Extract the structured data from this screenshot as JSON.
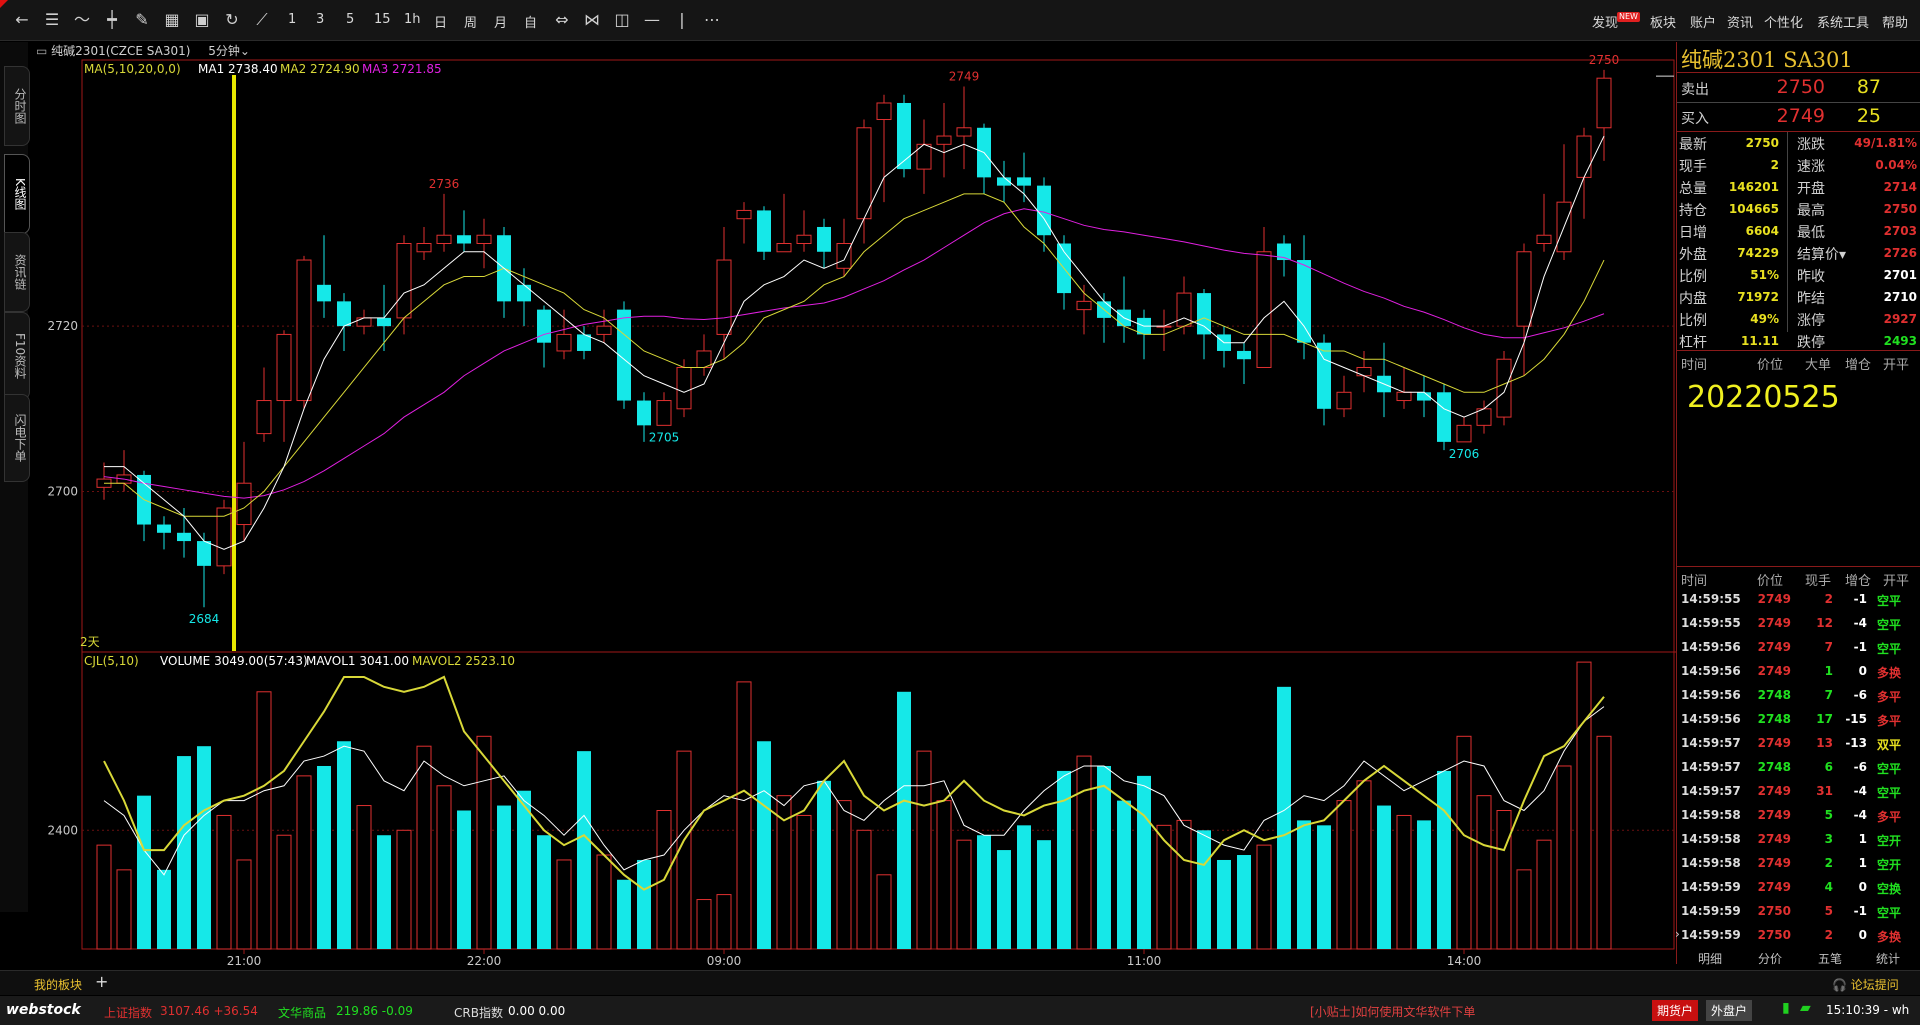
{
  "toolbar": {
    "nums": [
      "1",
      "3",
      "5",
      "15",
      "1h",
      "日",
      "周",
      "月",
      "自"
    ],
    "right_menu": [
      "发现",
      "板块",
      "账户",
      "资讯",
      "个性化",
      "系统工具",
      "帮助"
    ],
    "new_badge": "NEW"
  },
  "side_tabs": [
    "分时图",
    "K线图",
    "资讯链",
    "F10资料",
    "闪电下单"
  ],
  "header": {
    "instrument": "纯碱2301(CZCE SA301)",
    "period": "5分钟",
    "ma_label": "MA(5,10,20,0,0)",
    "ma1": "MA1 2738.40",
    "ma2": "MA2 2724.90",
    "ma3": "MA3 2721.85",
    "days_label": "2天",
    "vol_label": "CJL(5,10)",
    "vol_value": "VOLUME 3049.00(57:43)",
    "mavol1": "MAVOL1 3041.00",
    "mavol2": "MAVOL2 2523.10"
  },
  "colors": {
    "up": "#e03030",
    "down": "#16e8e8",
    "ma1": "#ffffff",
    "ma2": "#d8d838",
    "ma3": "#e020e0",
    "vcursor": "#e8e800",
    "grid": "#6a1010",
    "accent": "#e8c030"
  },
  "chart_data": {
    "type": "candlestick",
    "price_axis": {
      "ticks": [
        2700,
        2720
      ],
      "ylim": [
        2680.7,
        2752.2
      ]
    },
    "volume_axis": {
      "ticks": [
        2400
      ],
      "ylim": [
        0,
        5600
      ]
    },
    "time_ticks": [
      {
        "index": 7,
        "label": "21:00"
      },
      {
        "index": 19,
        "label": "22:00"
      },
      {
        "index": 31,
        "label": "09:00"
      },
      {
        "index": 52,
        "label": "11:00"
      },
      {
        "index": 68,
        "label": "14:00"
      }
    ],
    "highlight_index": 7,
    "candles": [
      [
        2700.5,
        2701.5,
        2703.5,
        2699
      ],
      [
        2701,
        2702,
        2705,
        2700
      ],
      [
        2702,
        2696,
        2702.5,
        2694
      ],
      [
        2696,
        2695,
        2697,
        2693
      ],
      [
        2695,
        2694,
        2698,
        2692
      ],
      [
        2694,
        2691,
        2695,
        2686
      ],
      [
        2691,
        2698,
        2699,
        2690
      ],
      [
        2696,
        2701,
        2706,
        2694
      ],
      [
        2707,
        2711,
        2715,
        2706
      ],
      [
        2711,
        2719,
        2719.5,
        2706
      ],
      [
        2711,
        2728,
        2728.5,
        2710
      ],
      [
        2725,
        2723,
        2731,
        2721
      ],
      [
        2723,
        2720,
        2724,
        2717
      ],
      [
        2720,
        2721,
        2722,
        2719
      ],
      [
        2721,
        2720,
        2725,
        2717
      ],
      [
        2721,
        2730,
        2731,
        2719
      ],
      [
        2729,
        2730,
        2732,
        2728
      ],
      [
        2730,
        2731,
        2736,
        2729
      ],
      [
        2731,
        2730,
        2734,
        2729
      ],
      [
        2730,
        2731,
        2733,
        2727
      ],
      [
        2731,
        2723,
        2732,
        2721
      ],
      [
        2725,
        2723,
        2727,
        2720
      ],
      [
        2722,
        2718,
        2722.5,
        2715
      ],
      [
        2717,
        2719,
        2722,
        2716
      ],
      [
        2719,
        2717,
        2720,
        2716
      ],
      [
        2719,
        2720,
        2722,
        2718
      ],
      [
        2722,
        2711,
        2723,
        2710
      ],
      [
        2711,
        2708,
        2712,
        2706
      ],
      [
        2708,
        2711,
        2712,
        2708
      ],
      [
        2710,
        2715,
        2716,
        2709
      ],
      [
        2715,
        2717,
        2719,
        2714
      ],
      [
        2719,
        2728,
        2732,
        2716
      ],
      [
        2733,
        2734,
        2735,
        2730
      ],
      [
        2734,
        2729,
        2734.5,
        2728
      ],
      [
        2729,
        2730,
        2736,
        2729
      ],
      [
        2730,
        2731,
        2734,
        2729
      ],
      [
        2732,
        2729,
        2733,
        2727
      ],
      [
        2727,
        2730,
        2733,
        2726
      ],
      [
        2733,
        2744,
        2745,
        2730
      ],
      [
        2745,
        2747,
        2748,
        2735
      ],
      [
        2747,
        2739,
        2748,
        2738
      ],
      [
        2739,
        2742,
        2745,
        2736
      ],
      [
        2742,
        2743,
        2747,
        2738
      ],
      [
        2743,
        2744,
        2749,
        2739
      ],
      [
        2744,
        2738,
        2744.5,
        2736
      ],
      [
        2738,
        2737,
        2740,
        2735
      ],
      [
        2738,
        2737,
        2741,
        2735
      ],
      [
        2737,
        2731,
        2738,
        2729
      ],
      [
        2730,
        2724,
        2731,
        2722
      ],
      [
        2722,
        2723,
        2725,
        2719
      ],
      [
        2723,
        2721,
        2724,
        2718
      ],
      [
        2722,
        2720,
        2726,
        2718
      ],
      [
        2721,
        2719,
        2722,
        2716
      ],
      [
        2720,
        2720,
        2722,
        2717
      ],
      [
        2720,
        2724,
        2726,
        2719
      ],
      [
        2724,
        2719,
        2724.5,
        2716
      ],
      [
        2719,
        2717,
        2720,
        2715
      ],
      [
        2717,
        2716,
        2718,
        2713
      ],
      [
        2715,
        2729,
        2732,
        2715
      ],
      [
        2730,
        2728,
        2731,
        2726
      ],
      [
        2728,
        2718,
        2731,
        2716
      ],
      [
        2718,
        2710,
        2719,
        2708
      ],
      [
        2710,
        2712,
        2714,
        2709
      ],
      [
        2714,
        2715,
        2717,
        2712
      ],
      [
        2714,
        2712,
        2718,
        2709
      ],
      [
        2711,
        2712,
        2715,
        2710
      ],
      [
        2712,
        2711,
        2714,
        2709
      ],
      [
        2712,
        2706,
        2713,
        2705
      ],
      [
        2706,
        2708,
        2709,
        2706
      ],
      [
        2708,
        2710,
        2711,
        2707
      ],
      [
        2709,
        2716,
        2717,
        2708
      ],
      [
        2720,
        2729,
        2730,
        2714
      ],
      [
        2730,
        2731,
        2736,
        2729
      ],
      [
        2729,
        2735,
        2742,
        2728
      ],
      [
        2738,
        2743,
        2744,
        2733
      ],
      [
        2744,
        2750,
        2751,
        2740
      ]
    ],
    "ma1": [
      2703,
      2703,
      2701,
      2699,
      2697,
      2694,
      2693,
      2694,
      2698,
      2703,
      2710,
      2716,
      2720,
      2721,
      2721,
      2724,
      2725,
      2727,
      2729,
      2729,
      2727,
      2725,
      2723,
      2721,
      2719,
      2718,
      2716,
      2714,
      2713,
      2712,
      2713,
      2718,
      2723,
      2725,
      2726,
      2728,
      2727,
      2728,
      2733,
      2738,
      2740,
      2742,
      2741,
      2742,
      2741,
      2738,
      2736,
      2733,
      2729,
      2726,
      2723,
      2721,
      2720,
      2720,
      2721,
      2720,
      2718,
      2718,
      2721,
      2723,
      2720,
      2716,
      2715,
      2714,
      2713,
      2712,
      2712,
      2710,
      2709,
      2710,
      2712,
      2718,
      2726,
      2732,
      2738,
      2743
    ],
    "ma2": [
      2701,
      2701,
      2699,
      2698,
      2697,
      2697,
      2697,
      2698,
      2700,
      2703,
      2706,
      2709,
      2712,
      2715,
      2718,
      2721,
      2723,
      2725,
      2726,
      2726,
      2727,
      2726,
      2725,
      2724,
      2722,
      2721,
      2719,
      2717,
      2716,
      2715,
      2715,
      2716,
      2718,
      2721,
      2722,
      2723,
      2725,
      2726,
      2729,
      2731,
      2733,
      2734,
      2735,
      2736,
      2736,
      2735,
      2732,
      2730,
      2727,
      2724,
      2722,
      2720,
      2719,
      2719,
      2720,
      2721,
      2720,
      2719,
      2719,
      2719,
      2718,
      2717,
      2717,
      2716,
      2716,
      2715,
      2714,
      2713,
      2712,
      2712,
      2713,
      2714,
      2716,
      2719,
      2723,
      2728
    ],
    "ma3": [
      2701.8,
      2701.5,
      2701,
      2700.6,
      2700.2,
      2699.8,
      2699.4,
      2699.2,
      2699.5,
      2700.2,
      2701.2,
      2702.5,
      2704,
      2705.5,
      2707,
      2709,
      2710.5,
      2712,
      2714,
      2715.5,
      2717,
      2718,
      2719,
      2719.6,
      2720.2,
      2720.6,
      2721,
      2721.2,
      2721.2,
      2720.9,
      2720.8,
      2721,
      2721.4,
      2721.8,
      2722.2,
      2722.5,
      2722.8,
      2723.5,
      2724.5,
      2725.5,
      2726.8,
      2728,
      2729.5,
      2731,
      2732.5,
      2733.6,
      2734.2,
      2733.8,
      2733,
      2732.2,
      2731.7,
      2731.4,
      2731,
      2730.6,
      2730.2,
      2729.7,
      2729.2,
      2728.8,
      2728.6,
      2728.3,
      2727.4,
      2726.3,
      2725.2,
      2724.2,
      2723.4,
      2722.4,
      2721.7,
      2720.8,
      2719.8,
      2719,
      2718.6,
      2718.6,
      2719.2,
      2719.8,
      2720.6,
      2721.5
    ],
    "volumes": [
      2100,
      1600,
      3100,
      1600,
      3900,
      4100,
      2700,
      1800,
      5200,
      2300,
      3500,
      3700,
      4200,
      2900,
      2300,
      2400,
      4100,
      3300,
      2800,
      4300,
      2900,
      3200,
      2300,
      1800,
      4000,
      1900,
      1400,
      1800,
      2800,
      4000,
      1000,
      1100,
      5400,
      4200,
      3100,
      2700,
      3400,
      3000,
      2400,
      1500,
      5200,
      4000,
      3000,
      2200,
      2300,
      2000,
      2500,
      2200,
      3600,
      3900,
      3700,
      3000,
      3500,
      2500,
      2600,
      2400,
      1800,
      1900,
      2100,
      5300,
      2600,
      2500,
      3000,
      3400,
      2900,
      2700,
      2600,
      3600,
      4300,
      3100,
      2800,
      1600,
      2200,
      3700,
      5800,
      4300,
      4500
    ],
    "mavol1": [
      3000,
      2700,
      2000,
      1500,
      2300,
      2700,
      3000,
      3000,
      3200,
      3300,
      3800,
      3900,
      4100,
      4000,
      3400,
      3200,
      3800,
      3500,
      3300,
      3400,
      3500,
      3000,
      2700,
      2300,
      2700,
      2100,
      1600,
      1800,
      1900,
      2400,
      2800,
      3100,
      3000,
      3200,
      2900,
      3300,
      3400,
      2800,
      2600,
      3000,
      3300,
      3300,
      3400,
      2500,
      2300,
      2300,
      2800,
      3200,
      3500,
      3700,
      3700,
      3400,
      3300,
      3100,
      2500,
      2300,
      2100,
      2000,
      2600,
      2800,
      3100,
      3000,
      3300,
      3800,
      3500,
      3200,
      3400,
      3600,
      3800,
      3700,
      3000,
      2800,
      3200,
      4000,
      4600,
      4900
    ],
    "mavol2": [
      3800,
      3000,
      2000,
      2000,
      2500,
      2800,
      3000,
      3100,
      3300,
      3600,
      4200,
      4800,
      5500,
      5500,
      5300,
      5200,
      5300,
      5500,
      4400,
      3900,
      3400,
      2900,
      2400,
      2100,
      2300,
      1900,
      1500,
      1200,
      1400,
      2200,
      2800,
      3000,
      3200,
      2900,
      2600,
      2800,
      3400,
      3800,
      3100,
      2800,
      3000,
      2900,
      3000,
      3400,
      3000,
      2800,
      2700,
      2900,
      3000,
      3200,
      3300,
      3000,
      2700,
      2200,
      1800,
      1700,
      2200,
      2400,
      2200,
      2300,
      2500,
      2600,
      3000,
      3400,
      3700,
      3400,
      3100,
      2800,
      2300,
      2100,
      2000,
      3000,
      3900,
      4100,
      4600,
      5100
    ],
    "labels": [
      {
        "index": 5,
        "text": "2684",
        "kind": "low"
      },
      {
        "index": 17,
        "text": "2736",
        "kind": "high"
      },
      {
        "index": 28,
        "text": "2705",
        "kind": "low"
      },
      {
        "index": 43,
        "text": "2749",
        "kind": "high"
      },
      {
        "index": 68,
        "text": "2706",
        "kind": "low"
      },
      {
        "index": 75,
        "text": "2750",
        "kind": "high"
      }
    ]
  },
  "quote": {
    "title": "纯碱2301  SA301",
    "ask": {
      "label": "卖出",
      "price": "2750",
      "vol": "87"
    },
    "bid": {
      "label": "买入",
      "price": "2749",
      "vol": "25"
    },
    "stats": [
      [
        "最新",
        "2750",
        "涨跌",
        "49/1.81%"
      ],
      [
        "现手",
        "2",
        "速涨",
        "0.04%"
      ],
      [
        "总量",
        "146201",
        "开盘",
        "2714"
      ],
      [
        "持仓",
        "104665",
        "最高",
        "2750"
      ],
      [
        "日增",
        "6604",
        "最低",
        "2703"
      ],
      [
        "外盘",
        "74229",
        "结算价▾",
        "2726"
      ],
      [
        "比例",
        "51%",
        "昨收",
        "2701"
      ],
      [
        "内盘",
        "71972",
        "昨结",
        "2710"
      ],
      [
        "比例",
        "49%",
        "涨停",
        "2927"
      ],
      [
        "杠杆",
        "11.11",
        "跌停",
        "2493"
      ]
    ],
    "big_order_head": [
      "时间",
      "价位",
      "大单",
      "增仓",
      "开平"
    ],
    "date": "20220525",
    "ticks_head": [
      "时间",
      "价位",
      "现手",
      "增仓",
      "开平"
    ],
    "ticks": [
      [
        "14:59:55",
        "2749",
        "2",
        "-1",
        "空平"
      ],
      [
        "14:59:55",
        "2749",
        "12",
        "-4",
        "空平"
      ],
      [
        "14:59:56",
        "2749",
        "7",
        "-1",
        "空平"
      ],
      [
        "14:59:56",
        "2749",
        "1",
        "0",
        "多换"
      ],
      [
        "14:59:56",
        "2748",
        "7",
        "-6",
        "多平"
      ],
      [
        "14:59:56",
        "2748",
        "17",
        "-15",
        "多平"
      ],
      [
        "14:59:57",
        "2749",
        "13",
        "-13",
        "双平"
      ],
      [
        "14:59:57",
        "2748",
        "6",
        "-6",
        "空平"
      ],
      [
        "14:59:57",
        "2749",
        "31",
        "-4",
        "空平"
      ],
      [
        "14:59:58",
        "2749",
        "5",
        "-4",
        "多平"
      ],
      [
        "14:59:58",
        "2749",
        "3",
        "1",
        "空开"
      ],
      [
        "14:59:58",
        "2749",
        "2",
        "1",
        "空开"
      ],
      [
        "14:59:59",
        "2749",
        "4",
        "0",
        "空换"
      ],
      [
        "14:59:59",
        "2750",
        "5",
        "-1",
        "空平"
      ],
      [
        "14:59:59",
        "2750",
        "2",
        "0",
        "多换"
      ]
    ],
    "bottom_tabs": [
      "明细",
      "分价",
      "五笔",
      "统计"
    ]
  },
  "footer": {
    "my_board": "我的板块",
    "logo": "webstock",
    "idx1_name": "上证指数",
    "idx1_val": "3107.46 +36.54",
    "idx2_name": "文华商品",
    "idx2_val": "219.86 -0.09",
    "idx3_name": "CRB指数",
    "idx3_val": "0.00 0.00",
    "forum": "论坛提问",
    "tip": "[小贴士]如何使用文华软件下单",
    "btn1": "期货户",
    "btn2": "外盘户",
    "time": "15:10:39 - wh"
  }
}
